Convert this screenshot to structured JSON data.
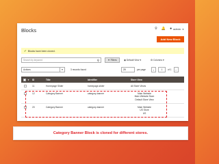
{
  "header": {
    "page_title": "Blocks",
    "user": "admin",
    "add_button": "Add New Block"
  },
  "message": {
    "text": "Blocks have been cloned."
  },
  "toolbar": {
    "search_placeholder": "Search by keyword",
    "filters_label": "Filters",
    "default_view_label": "Default View",
    "columns_label": "Columns",
    "actions_label": "Actions",
    "records_found": "3 records found",
    "per_page_value": "20",
    "per_page_label": "per page",
    "page_current": "1",
    "page_total": "of 1"
  },
  "grid": {
    "columns": [
      "ID",
      "Title",
      "Identifier",
      "Store View"
    ],
    "rows": [
      {
        "id": "11",
        "title": "Homepage Slider",
        "identifier": "homepage-slider",
        "store_view": "All Store Views"
      },
      {
        "id": "12",
        "title": "Category Banner",
        "identifier": "category-banner",
        "store_view": "Main Website\nMain Website Store\nDefault Store View"
      },
      {
        "id": "20",
        "title": "Category Banner",
        "identifier": "category-banner",
        "store_view": "Main Website\nUS Store\nUS"
      }
    ]
  },
  "caption": {
    "text": "Category Banner Block is cloned for different stores."
  },
  "colors": {
    "accent": "#eb5202",
    "highlight_red": "#e0262b",
    "grid_header": "#514943"
  }
}
